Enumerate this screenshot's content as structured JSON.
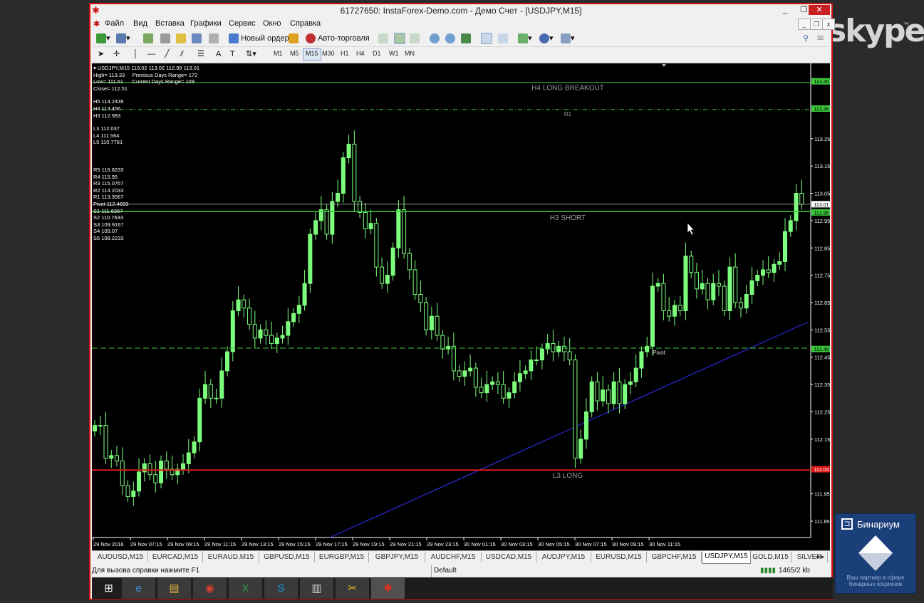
{
  "window": {
    "title": "61727650: InstaForex-Demo.com - Демо Счет - [USDJPY,M15]",
    "controls": [
      "_",
      "❐",
      "✕"
    ],
    "mdi_controls": [
      "_",
      "❐",
      "x"
    ]
  },
  "menu": [
    "Файл",
    "Вид",
    "Вставка",
    "Графики",
    "Сервис",
    "Окно",
    "Справка"
  ],
  "toolbar": {
    "new_order_label": "Новый ордер",
    "auto_trading_label": "Авто-торговля",
    "timeframes": [
      "M1",
      "M5",
      "M15",
      "M30",
      "H1",
      "H4",
      "D1",
      "W1",
      "MN"
    ],
    "active_timeframe": "M15"
  },
  "chart": {
    "header": "USDJPY,M15  113.02 113.02 112.99 113.01",
    "stats": [
      "High= 113.33     Previous Days Range= 172",
      "Low= 111.61      Current Days Range= 109",
      "Close= 112.51"
    ],
    "camarilla": [
      "H5 114.2439",
      "H4 113.456",
      "H3 112.983",
      "",
      "L3 112.037",
      "L4 111.564",
      "L5 110.7761"
    ],
    "pivots": [
      "R5 116.8233",
      "R4 115.95",
      "R3 115.0767",
      "R2 114.2033",
      "R1 113.3567",
      "Pivot 112.4833",
      "S1 111.6367",
      "S2 110.7633",
      "S3 109.9167",
      "S4 109.07",
      "S5 108.2233"
    ],
    "level_labels": {
      "h4": "H4 LONG BREAKOUT",
      "r1": "R1",
      "h3": "H3 SHORT",
      "pivot": "Pivot",
      "l3": "L3 LONG"
    },
    "price_axis": [
      "113.46",
      "113.36",
      "113.25",
      "113.15",
      "113.05",
      "113.01",
      "112.98",
      "112.95",
      "112.85",
      "112.75",
      "112.65",
      "112.55",
      "112.48",
      "112.45",
      "112.35",
      "112.25",
      "112.15",
      "112.04",
      "111.95",
      "111.85"
    ],
    "time_axis": [
      "29 Nov 2016",
      "29 Nov 07:15",
      "29 Nov 09:15",
      "29 Nov 11:15",
      "29 Nov 13:15",
      "29 Nov 15:15",
      "29 Nov 17:15",
      "29 Nov 19:15",
      "29 Nov 21:15",
      "29 Nov 23:15",
      "30 Nov 01:15",
      "30 Nov 03:15",
      "30 Nov 05:15",
      "30 Nov 07:15",
      "30 Nov 09:15",
      "30 Nov 11:15"
    ],
    "colors": {
      "candle": "#7cff7c",
      "level_green": "#3cc83c",
      "level_red": "#e01818",
      "trendline": "#2a2ad8"
    }
  },
  "chart_data": {
    "type": "candlestick",
    "symbol": "USDJPY",
    "timeframe": "M15",
    "ylim": [
      111.79,
      113.51
    ],
    "levels": [
      {
        "name": "H4 LONG BREAKOUT",
        "value": 113.456
      },
      {
        "name": "R1",
        "value": 113.3567
      },
      {
        "name": "H3 SHORT",
        "value": 112.983
      },
      {
        "name": "Pivot",
        "value": 112.4833
      },
      {
        "name": "L3 LONG",
        "value": 112.037
      }
    ],
    "current_price": 113.01,
    "closes": [
      112.2,
      112.2,
      112.08,
      112.09,
      112.07,
      111.98,
      111.94,
      111.96,
      112.03,
      112.06,
      112.02,
      111.99,
      112.07,
      112.04,
      112.02,
      112.04,
      112.06,
      112.1,
      112.14,
      112.3,
      112.35,
      112.3,
      112.3,
      112.4,
      112.47,
      112.62,
      112.66,
      112.63,
      112.57,
      112.52,
      112.55,
      112.53,
      112.5,
      112.52,
      112.53,
      112.58,
      112.61,
      112.64,
      112.72,
      112.9,
      112.95,
      112.99,
      112.9,
      113.02,
      113.05,
      113.18,
      113.23,
      113.02,
      112.98,
      112.92,
      112.94,
      112.78,
      112.72,
      112.75,
      112.85,
      112.99,
      112.83,
      112.77,
      112.68,
      112.65,
      112.55,
      112.6,
      112.53,
      112.48,
      112.49,
      112.4,
      112.38,
      112.4,
      112.41,
      112.34,
      112.32,
      112.35,
      112.36,
      112.35,
      112.3,
      112.32,
      112.36,
      112.39,
      112.4,
      112.44,
      112.44,
      112.48,
      112.5,
      112.47,
      112.49,
      112.47,
      112.44,
      112.08,
      112.15,
      112.25,
      112.36,
      112.29,
      112.33,
      112.28,
      112.36,
      112.28,
      112.35,
      112.36,
      112.41,
      112.47,
      112.49,
      112.71,
      112.72,
      112.62,
      112.6,
      112.64,
      112.62,
      112.82,
      112.76,
      112.7,
      112.72,
      112.66,
      112.72,
      112.71,
      112.62,
      112.78,
      112.65,
      112.63,
      112.68,
      112.73,
      112.75,
      112.77,
      112.76,
      112.79,
      112.8,
      112.91,
      112.95,
      113.05,
      113.01
    ]
  },
  "tabs": [
    "AUDUSD,M15",
    "EURCAD,M15",
    "EURAUD,M15",
    "GBPUSD,M15",
    "EURGBP,M15",
    "GBPJPY,M15",
    "AUDCHF,M15",
    "USDCAD,M15",
    "AUDJPY,M15",
    "EURUSD,M15",
    "GBPCHF,M15",
    "USDJPY,M15",
    "GOLD,M15",
    "SILVER"
  ],
  "active_tab": "USDJPY,M15",
  "status": {
    "help": "Для вызова справки нажмите F1",
    "profile": "Default",
    "traffic": "1465/2 kb"
  },
  "taskbar": [
    "start-icon",
    "ie-icon",
    "explorer-icon",
    "chrome-icon",
    "excel-icon",
    "skype-icon",
    "clipboard-icon",
    "tool-icon",
    "mt4-icon"
  ],
  "overlay": {
    "skype_logo": "skype",
    "binarium_name": "Бинариум",
    "binarium_tagline": "Ваш партнер в сфере бинарных опционов"
  }
}
